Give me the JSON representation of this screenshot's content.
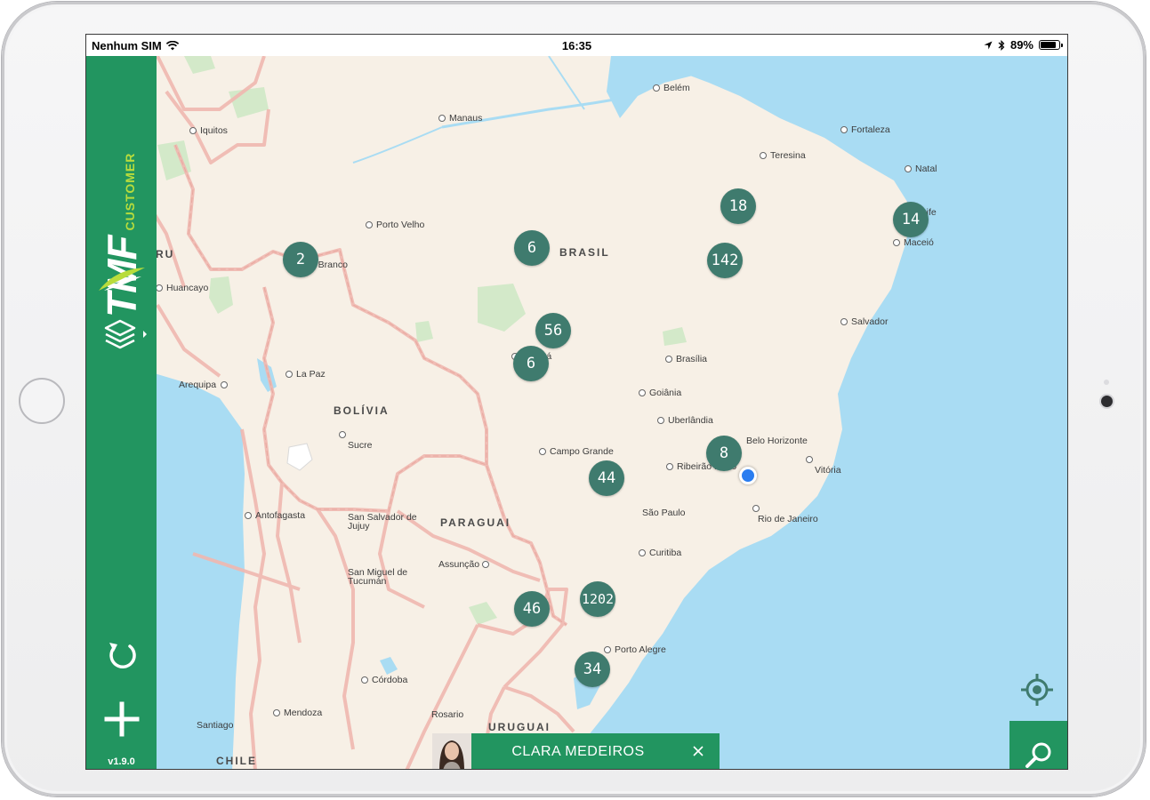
{
  "status_bar": {
    "carrier": "Nenhum SIM",
    "time": "16:35",
    "battery": "89%",
    "battery_level": 0.89
  },
  "sidebar": {
    "brand": "TMF",
    "brand_sub": "CUSTOMER",
    "version": "v1.9.0",
    "icons": [
      "layers-icon",
      "refresh-icon",
      "add-icon"
    ]
  },
  "map": {
    "countries": {
      "brasil": "BRASIL",
      "bolivia": "BOLÍVIA",
      "paraguai": "PARAGUAI",
      "uruguai": "URUGUAI",
      "chile": "CHILE",
      "peru_partial": "RU"
    },
    "cities": {
      "belem": "Belém",
      "manaus": "Manaus",
      "iquitos": "Iquitos",
      "fortaleza": "Fortaleza",
      "teresina": "Teresina",
      "natal": "Natal",
      "recife": "Recife",
      "maceio": "Maceió",
      "porto_velho": "Porto Velho",
      "rio_branco": "Rio Branco",
      "huancayo": "Huancayo",
      "salvador": "Salvador",
      "cuiaba": "Cuiabá",
      "brasilia": "Brasília",
      "la_paz": "La Paz",
      "arequipa": "Arequipa",
      "goiania": "Goiânia",
      "sucre": "Sucre",
      "uberlandia": "Uberlândia",
      "belo_horizonte": "Belo Horizonte",
      "campo_grande": "Campo Grande",
      "ribeirao_preto": "Ribeirão Preto",
      "vitoria": "Vitória",
      "antofagasta": "Antofagasta",
      "san_salvador": "San Salvador de Jujuy",
      "sao_paulo": "São Paulo",
      "rio_de_janeiro": "Rio de Janeiro",
      "curitiba": "Curitiba",
      "assuncao": "Assunção",
      "san_miguel": "San Miguel de Tucumán",
      "porto_alegre": "Porto Alegre",
      "cordoba": "Córdoba",
      "mendoza": "Mendoza",
      "rosario": "Rosario",
      "santiago": "Santiago"
    },
    "clusters": {
      "c1": "18",
      "c2": "14",
      "c3": "2",
      "c4": "6",
      "c5": "142",
      "c6": "56",
      "c7": "6",
      "c8": "8",
      "c9": "44",
      "c10": "1202",
      "c11": "46",
      "c12": "34"
    },
    "colors": {
      "land": "#f7f0e6",
      "water": "#a9dcf3",
      "park": "#d3e9c9",
      "border": "#f0b8b0",
      "cluster": "#3f7b6e",
      "accent": "#229560",
      "brand_sub": "#b8dc3c"
    }
  },
  "user_bar": {
    "name": "CLARA MEDEIROS"
  },
  "controls": {
    "locate": "crosshair-icon",
    "search": "search-icon",
    "close": "close-icon"
  }
}
